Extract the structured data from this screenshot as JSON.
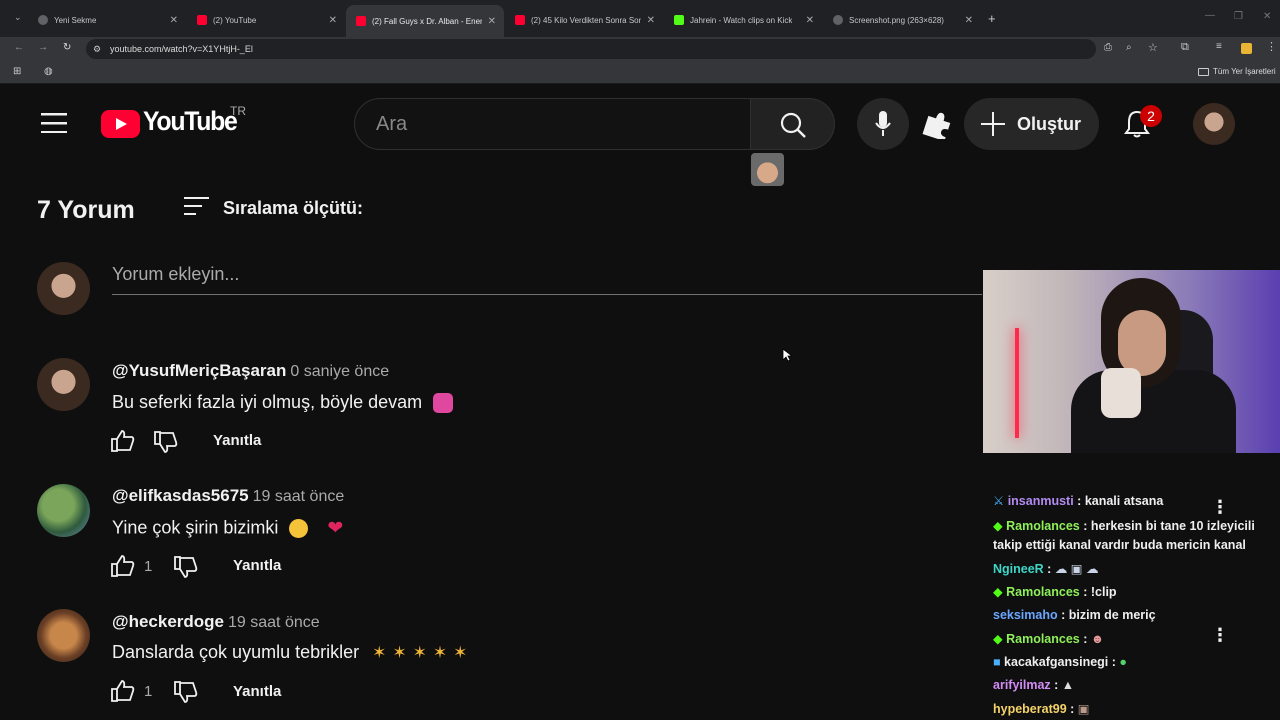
{
  "browser": {
    "tabs": [
      {
        "label": "Yeni Sekme",
        "color": "#9aa0a6"
      },
      {
        "label": "(2) YouTube",
        "color": "#ff0033"
      },
      {
        "label": "(2) Fall Guys x Dr. Alban - Energ",
        "color": "#ff0033"
      },
      {
        "label": "(2) 45 Kilo Verdikten Sonra Son",
        "color": "#ff0033"
      },
      {
        "label": "Jahrein - Watch clips on Kick",
        "color": "#53fc18"
      },
      {
        "label": "Screenshot.png (263×628)",
        "color": "#9aa0a6"
      }
    ],
    "url": "youtube.com/watch?v=X1YHtjH-_El",
    "bookmarks_label": "Tüm Yer İşaretleri"
  },
  "youtube": {
    "logo_text": "YouTube",
    "region": "TR",
    "search_placeholder": "Ara",
    "create_label": "Oluştur",
    "notifications_count": "2"
  },
  "comments": {
    "count_label": "7 Yorum",
    "sort_label": "Sıralama ölçütü:",
    "add_placeholder": "Yorum ekleyin...",
    "reply_label": "Yanıtla",
    "items": [
      {
        "author": "@YusufMeriçBaşaran",
        "time": "0 saniye önce",
        "text": "Bu seferki fazla iyi olmuş, böyle devam",
        "likes": ""
      },
      {
        "author": "@elifkasdas5675",
        "time": "19 saat önce",
        "text": "Yine çok şirin bizimki",
        "likes": "1"
      },
      {
        "author": "@heckerdoge",
        "time": "19 saat önce",
        "text": "Danslarda çok uyumlu tebrikler",
        "likes": "1"
      }
    ]
  },
  "chat": {
    "messages": [
      {
        "user": "insanmusti",
        "color": "#b38bf0",
        "text": "kanali atsana"
      },
      {
        "user": "Ramolances",
        "color": "#8ff05a",
        "text": "herkesin bi tane 10 izleyicili takip ettiği kanal vardır buda mericin kanal"
      },
      {
        "user": "NgineeR",
        "color": "#3ed6c6",
        "text": ""
      },
      {
        "user": "Ramolances",
        "color": "#8ff05a",
        "text": "!clip"
      },
      {
        "user": "seksimaho",
        "color": "#6aa6ff",
        "text": "bizim de meriç"
      },
      {
        "user": "Ramolances",
        "color": "#8ff05a",
        "text": ""
      },
      {
        "user": "kacakafgansinegi",
        "color": "#efeff1",
        "text": ""
      },
      {
        "user": "arifyilmaz",
        "color": "#d28cf5",
        "text": ""
      },
      {
        "user": "hypeberat99",
        "color": "#f5d36a",
        "text": ""
      }
    ]
  }
}
